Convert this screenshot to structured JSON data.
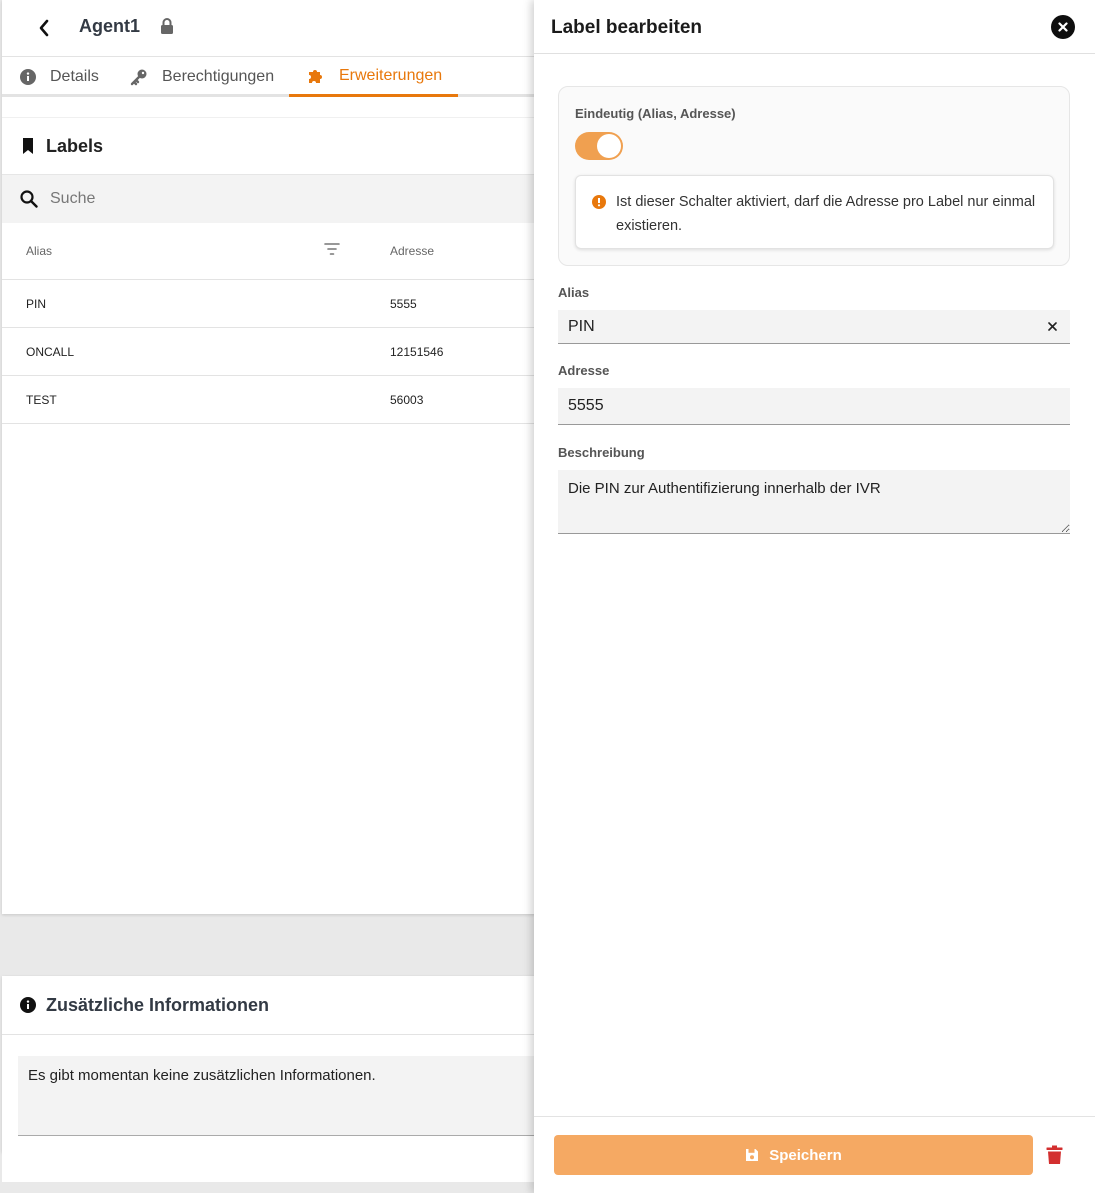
{
  "header": {
    "agent_name": "Agent1"
  },
  "tabs": [
    {
      "label": "Details"
    },
    {
      "label": "Berechtigungen"
    },
    {
      "label": "Erweiterungen"
    }
  ],
  "labels": {
    "title": "Labels",
    "search_placeholder": "Suche",
    "columns": [
      "Alias",
      "Adresse"
    ],
    "rows": [
      {
        "alias": "PIN",
        "address": "5555"
      },
      {
        "alias": "ONCALL",
        "address": "12151546"
      },
      {
        "alias": "TEST",
        "address": "56003"
      }
    ]
  },
  "additional_info": {
    "title": "Zusätzliche Informationen",
    "text": "Es gibt momentan keine zusätzlichen Informationen."
  },
  "drawer": {
    "title": "Label bearbeiten",
    "unique_label": "Eindeutig (Alias, Adresse)",
    "unique_enabled": true,
    "notice": "Ist dieser Schalter aktiviert, darf die Adresse pro Label nur einmal existieren.",
    "alias_label": "Alias",
    "alias_value": "PIN",
    "address_label": "Adresse",
    "address_value": "5555",
    "description_label": "Beschreibung",
    "description_value": "Die PIN zur Authentifizierung innerhalb der IVR",
    "save_label": "Speichern"
  },
  "colors": {
    "accent": "#e8780c",
    "toggle_on": "#f0a050",
    "save_button": "#f5a963",
    "delete": "#d32f2f"
  }
}
